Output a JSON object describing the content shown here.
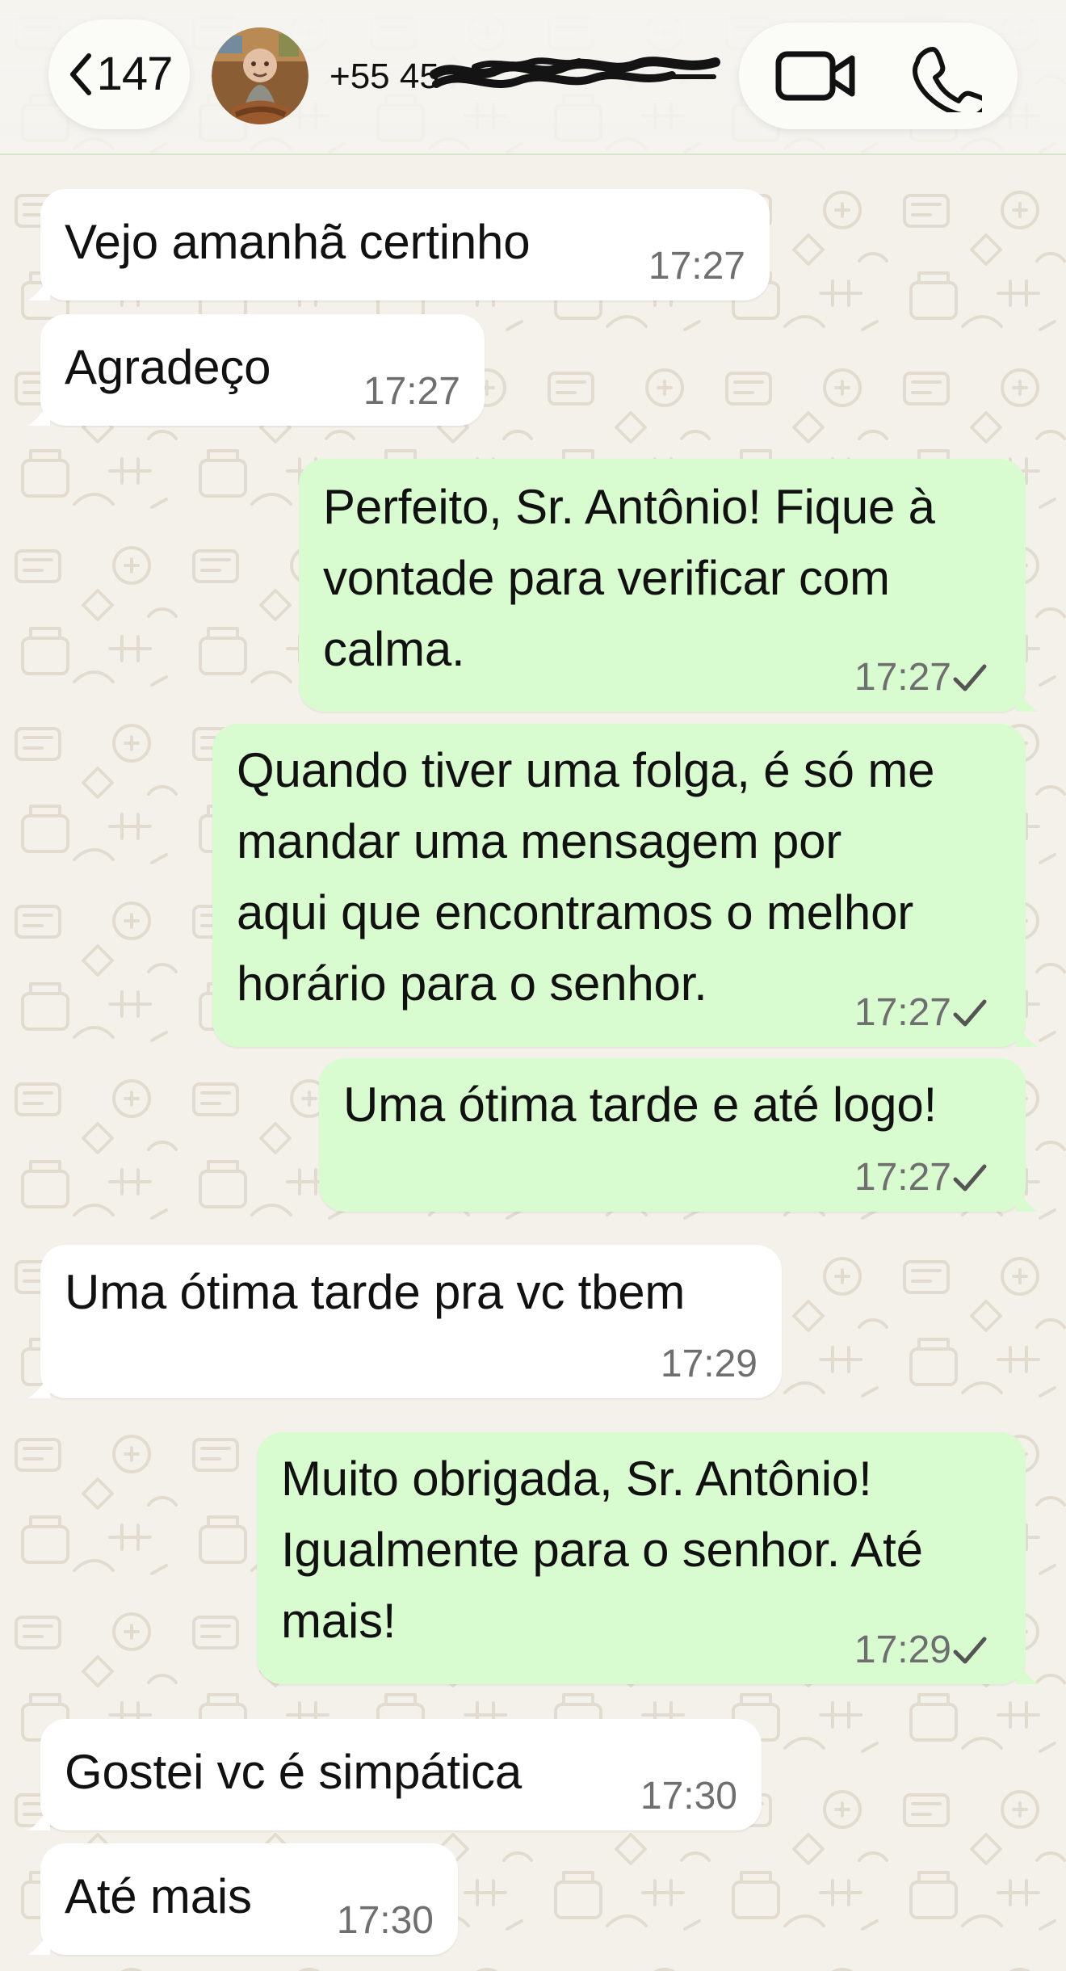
{
  "header": {
    "back_count": "147",
    "contact_name": "+55 45",
    "actions": {
      "video": "video-camera-icon",
      "call": "phone-icon"
    }
  },
  "messages": [
    {
      "direction": "received",
      "text": "Vejo amanhã certinho",
      "time": "17:27"
    },
    {
      "direction": "received",
      "text": "Agradeço",
      "time": "17:27"
    },
    {
      "direction": "sent",
      "text": "Perfeito, Sr. Antônio! Fique à\nvontade para verificar com\ncalma.",
      "time": "17:27",
      "status": "sent"
    },
    {
      "direction": "sent",
      "text": "Quando tiver uma folga, é só me\nmandar uma mensagem por\naqui que encontramos o melhor\nhorário para o senhor.",
      "time": "17:27",
      "status": "sent"
    },
    {
      "direction": "sent",
      "text": "Uma ótima tarde e até logo!",
      "time": "17:27",
      "status": "sent"
    },
    {
      "direction": "received",
      "text": "Uma ótima tarde pra vc tbem",
      "time": "17:29"
    },
    {
      "direction": "sent",
      "text": "Muito obrigada, Sr. Antônio!\nIgualmente para o senhor. Até\nmais!",
      "time": "17:29",
      "status": "sent"
    },
    {
      "direction": "received",
      "text": "Gostei vc é simpática",
      "time": "17:30"
    },
    {
      "direction": "received",
      "text": "Até mais",
      "time": "17:30"
    }
  ],
  "colors": {
    "background": "#f4f1ea",
    "received_bubble": "#ffffff",
    "sent_bubble": "#d8fbd0",
    "timestamp": "#6f6f6f",
    "doodle": "#d8d1c3"
  }
}
